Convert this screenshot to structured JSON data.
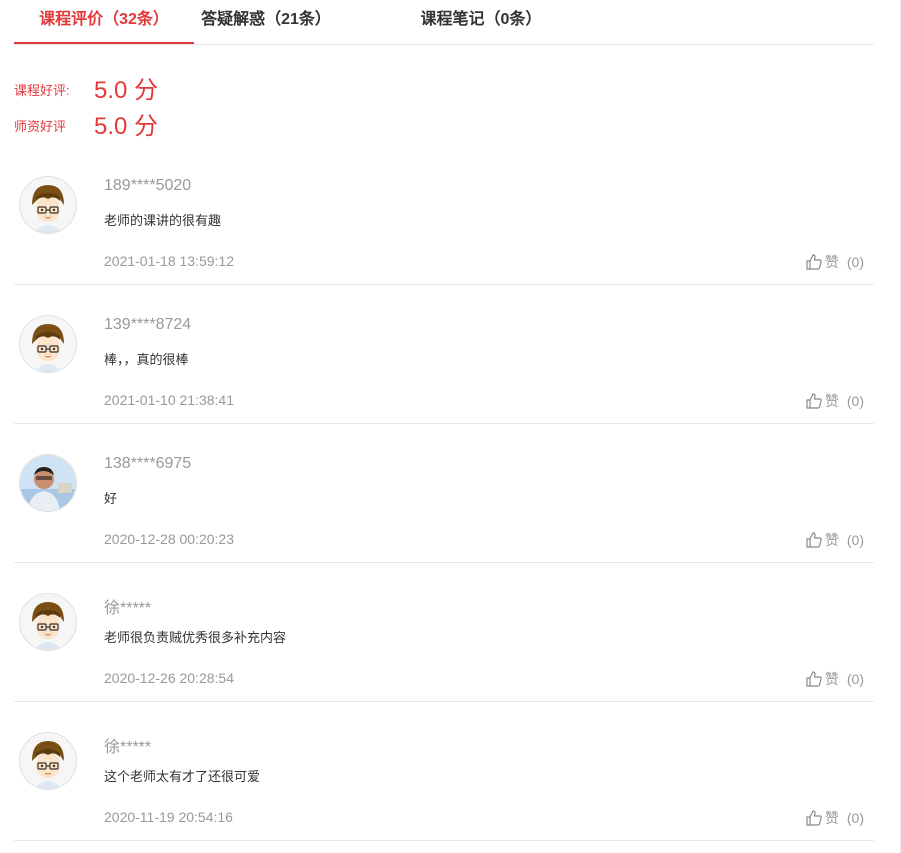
{
  "tabs": [
    {
      "label": "课程评价（32条）",
      "active": true
    },
    {
      "label": "答疑解惑（21条）",
      "active": false
    },
    {
      "label": "课程笔记（0条）",
      "active": false
    }
  ],
  "ratings": [
    {
      "label": "课程好评:",
      "value": "5.0 分"
    },
    {
      "label": "师资好评",
      "value": "5.0 分"
    }
  ],
  "comments": [
    {
      "user": "189****5020",
      "text": "老师的课讲的很有趣",
      "time": "2021-01-18 13:59:12",
      "like_label": "赞",
      "like_count": "(0)",
      "avatar": "cartoon-boy"
    },
    {
      "user": "139****8724",
      "text": "棒，，真的很棒",
      "time": "2021-01-10 21:38:41",
      "like_label": "赞",
      "like_count": "(0)",
      "avatar": "cartoon-boy"
    },
    {
      "user": "138****6975",
      "text": "好",
      "time": "2020-12-28 00:20:23",
      "like_label": "赞",
      "like_count": "(0)",
      "avatar": "photo"
    },
    {
      "user": "徐*****",
      "text": "老师很负责贼优秀很多补充内容",
      "time": "2020-12-26 20:28:54",
      "like_label": "赞",
      "like_count": "(0)",
      "avatar": "cartoon-boy"
    },
    {
      "user": "徐*****",
      "text": "这个老师太有才了还很可爱",
      "time": "2020-11-19 20:54:16",
      "like_label": "赞",
      "like_count": "(0)",
      "avatar": "cartoon-boy"
    }
  ],
  "colors": {
    "accent": "#e5383b",
    "muted": "#999999",
    "divider": "#e8e8e8"
  }
}
